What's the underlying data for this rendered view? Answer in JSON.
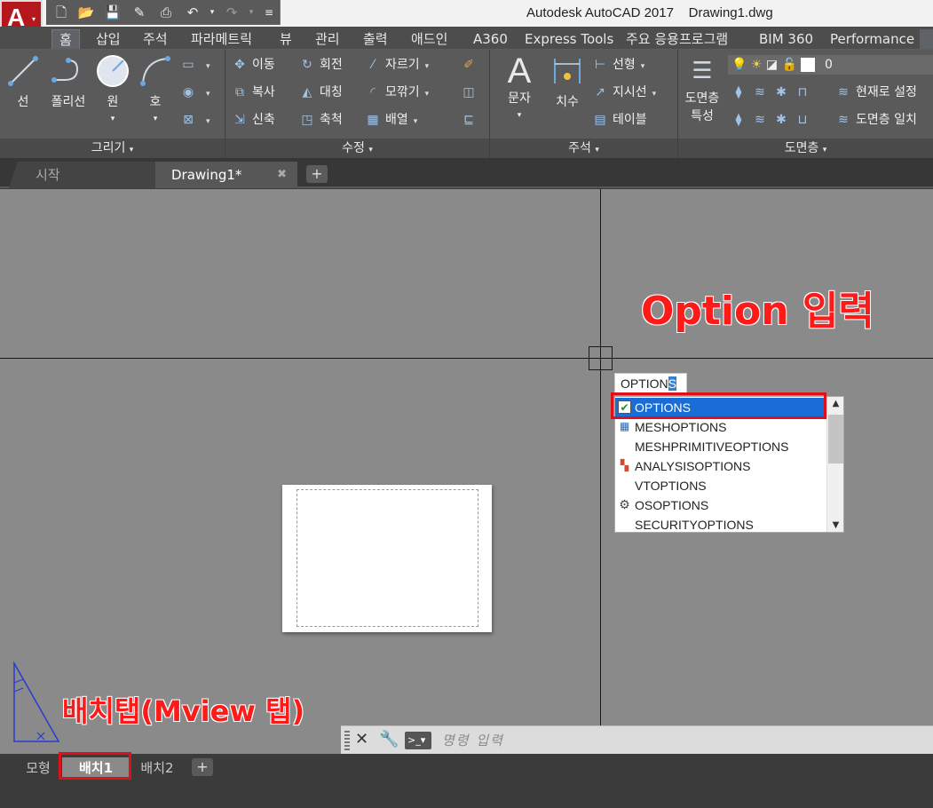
{
  "title_bar": {
    "app_name": "Autodesk AutoCAD 2017",
    "file_name": "Drawing1.dwg"
  },
  "ribbon_tabs": [
    "홈",
    "삽입",
    "주석",
    "파라메트릭",
    "뷰",
    "관리",
    "출력",
    "애드인",
    "A360",
    "Express Tools",
    "주요 응용프로그램",
    "BIM 360",
    "Performance"
  ],
  "ribbon": {
    "draw": {
      "title": "그리기",
      "line": "선",
      "polyline": "폴리선",
      "circle": "원",
      "arc": "호"
    },
    "modify": {
      "title": "수정",
      "move": "이동",
      "rotate": "회전",
      "trim": "자르기",
      "copy": "복사",
      "mirror": "대칭",
      "fillet": "모깎기",
      "stretch": "신축",
      "scale": "축척",
      "array": "배열"
    },
    "annotation": {
      "title": "주석",
      "text": "문자",
      "dimension": "치수",
      "linear": "선형",
      "leader": "지시선",
      "table": "테이블"
    },
    "layers": {
      "title": "도면층",
      "layer_properties_line1": "도면층",
      "layer_properties_line2": "특성",
      "current_layer": "0",
      "set_current": "현재로 설정",
      "match_layer": "도면층 일치"
    }
  },
  "doc_tabs": {
    "start": "시작",
    "drawing": "Drawing1*"
  },
  "annotations": {
    "option_input": "Option 입력",
    "layout_tab": "배치탭(Mview 탭)"
  },
  "command_input": {
    "typed": "OPTION",
    "highlight": "S"
  },
  "autocomplete": [
    {
      "label": "OPTIONS",
      "icon": "check-icon",
      "selected": true
    },
    {
      "label": "MESHOPTIONS",
      "icon": "mesh-icon",
      "selected": false
    },
    {
      "label": "MESHPRIMITIVEOPTIONS",
      "icon": "",
      "selected": false
    },
    {
      "label": "ANALYSISOPTIONS",
      "icon": "analysis-icon",
      "selected": false
    },
    {
      "label": "VTOPTIONS",
      "icon": "",
      "selected": false
    },
    {
      "label": "OSOPTIONS",
      "icon": "gear-icon",
      "selected": false
    },
    {
      "label": "SECURITYOPTIONS",
      "icon": "",
      "selected": false
    }
  ],
  "command_line": {
    "placeholder": "명령 입력"
  },
  "layout_tabs": {
    "model": "모형",
    "layout1": "배치1",
    "layout2": "배치2"
  },
  "colors": {
    "annotation_red": "#ff1a1a",
    "selection_blue": "#1a6dd6",
    "canvas_gray": "#8a8a8a"
  }
}
